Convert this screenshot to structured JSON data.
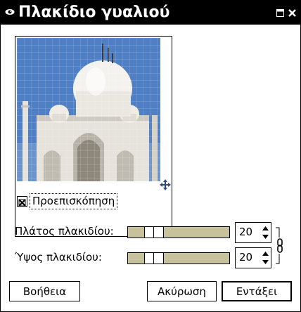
{
  "window": {
    "title": "Πλακίδιο γυαλιού"
  },
  "preview": {
    "checkbox_checked": true,
    "label": "Προεπισκόπηση"
  },
  "controls": {
    "tile_width": {
      "label": "Πλάτος πλακιδίου:",
      "value": "20",
      "slider_fraction": 0.2
    },
    "tile_height": {
      "label": "Ύψος πλακιδίου:",
      "value": "20",
      "slider_fraction": 0.2
    },
    "chain_linked": true
  },
  "buttons": {
    "help": "Βοήθεια",
    "cancel": "Ακύρωση",
    "ok": "Εντάξει"
  },
  "colors": {
    "titlebar": "#000000",
    "slider_trough": "#c7c29b",
    "sky": "#4f7fc4"
  }
}
